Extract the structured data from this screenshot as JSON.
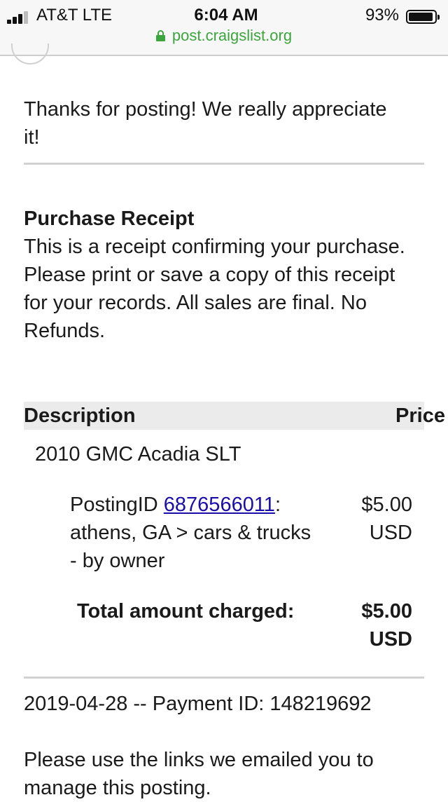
{
  "status_bar": {
    "carrier": "AT&T  LTE",
    "time": "6:04 AM",
    "battery_percent": "93%",
    "battery_level": 0.93
  },
  "browser": {
    "url": "post.craigslist.org"
  },
  "page": {
    "thanks_message": "Thanks for posting! We really appreciate it!",
    "receipt_title": "Purchase Receipt",
    "receipt_text": "This is a receipt confirming your purchase. Please print or save a copy of this receipt for your records. All sales are final. No Refunds.",
    "table": {
      "header_description": "Description",
      "header_price": "Price",
      "item_name": "2010 GMC Acadia SLT",
      "line_prefix": "PostingID ",
      "posting_id": "6876566011",
      "line_suffix": ": athens, GA > cars & trucks - by owner",
      "line_price": "$5.00",
      "line_currency": "USD",
      "total_label": "Total amount charged:",
      "total_price": "$5.00",
      "total_currency": "USD"
    },
    "payment_line": "2019-04-28 -- Payment ID: 148219692",
    "footer_note": "Please use the links we emailed you to manage this posting."
  },
  "colors": {
    "link": "#1a0dab",
    "url_green": "#3da53d",
    "rule": "#d2d2d2",
    "header_bg": "#ebebeb"
  }
}
